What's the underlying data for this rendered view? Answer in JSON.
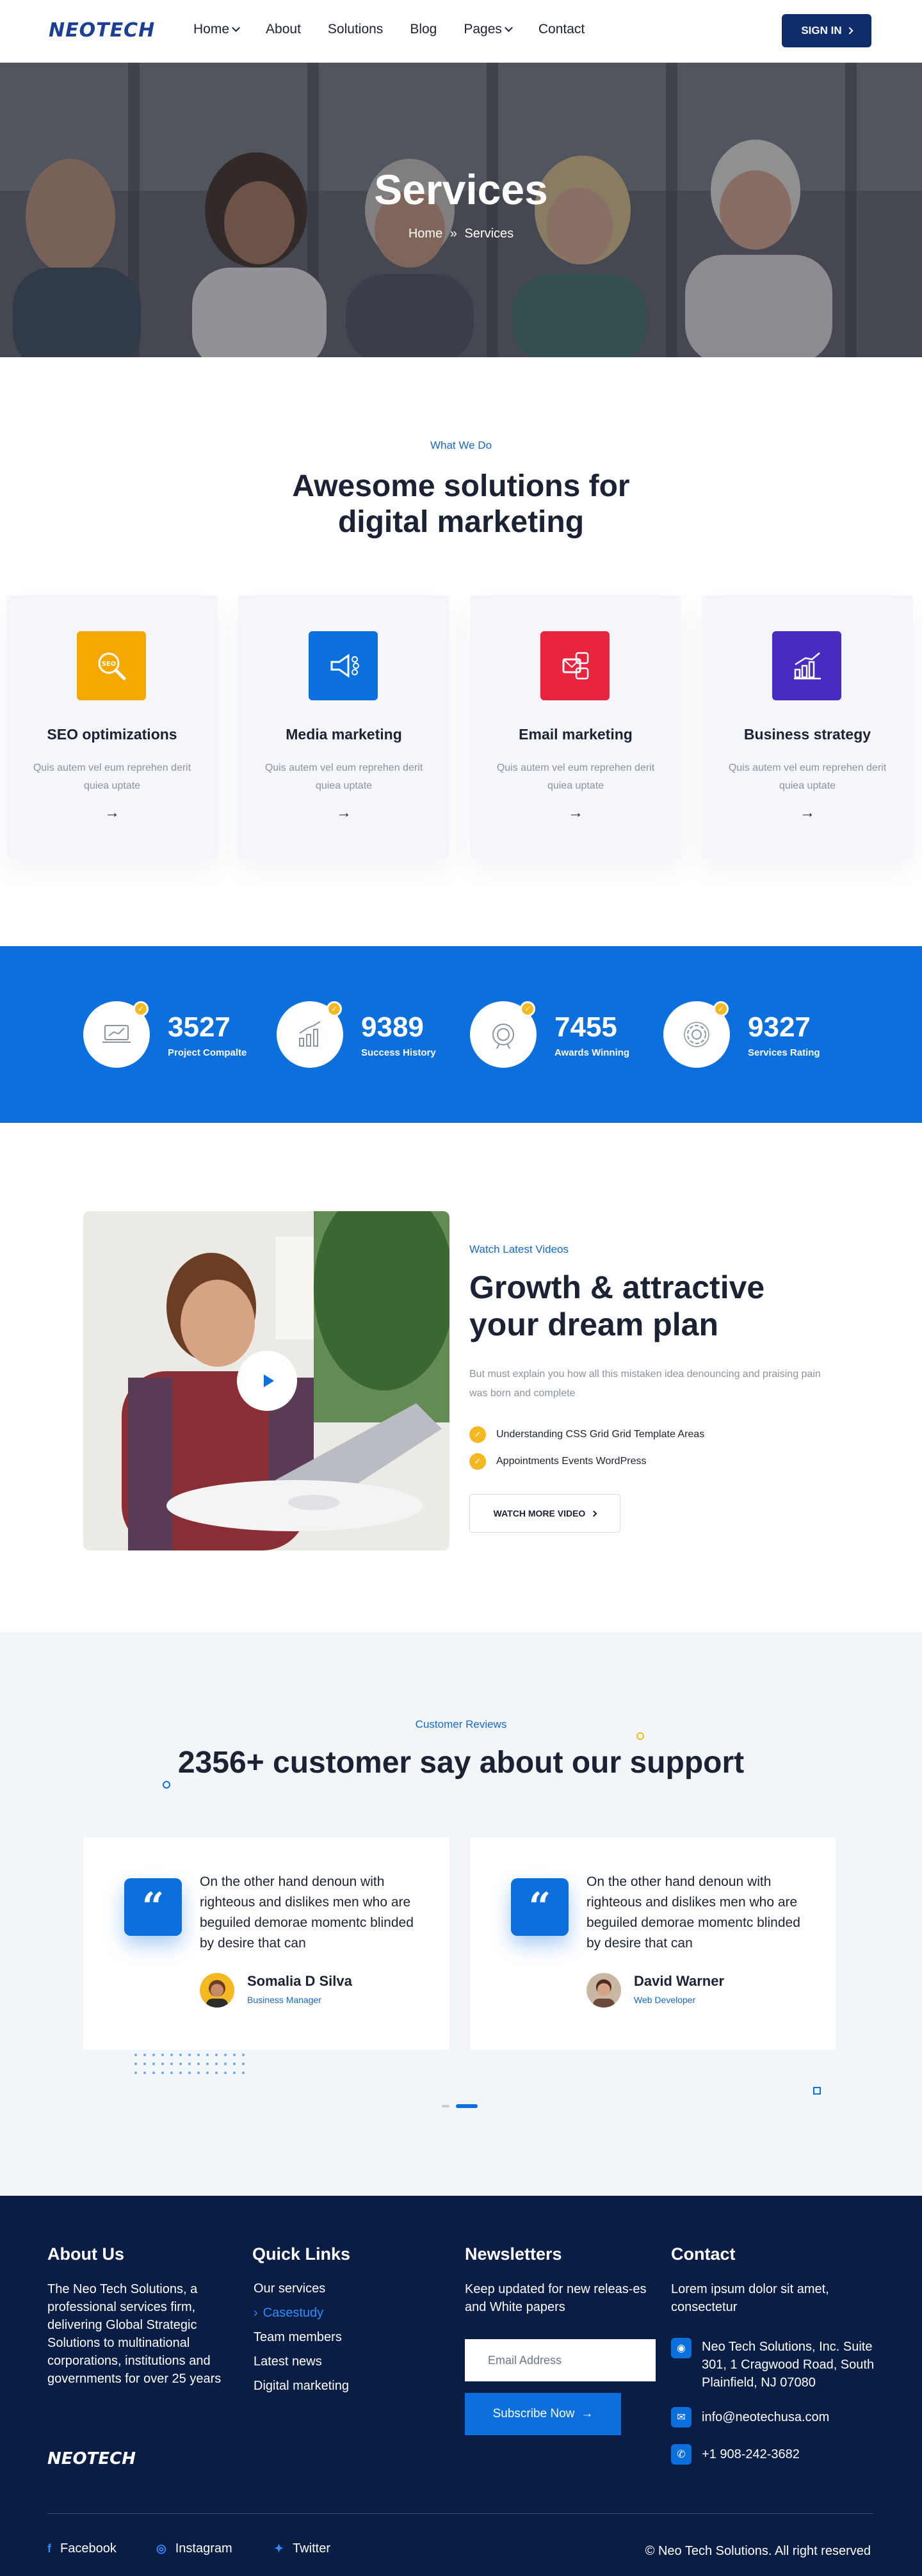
{
  "header": {
    "logo": "NEOTECH",
    "nav": [
      {
        "label": "Home",
        "dropdown": true
      },
      {
        "label": "About",
        "dropdown": false
      },
      {
        "label": "Solutions",
        "dropdown": false
      },
      {
        "label": "Blog",
        "dropdown": false
      },
      {
        "label": "Pages",
        "dropdown": true
      },
      {
        "label": "Contact",
        "dropdown": false
      }
    ],
    "signin_label": "SIGN IN"
  },
  "hero": {
    "title": "Services",
    "breadcrumb_home": "Home",
    "breadcrumb_sep": "»",
    "breadcrumb_current": "Services"
  },
  "what_we_do": {
    "kicker": "What We Do",
    "title_line1": "Awesome solutions for",
    "title_line2": "digital marketing",
    "cards": [
      {
        "title": "SEO optimizations",
        "text": "Quis autem vel eum reprehen derit quiea uptate",
        "icon": "seo-icon",
        "color": "#f5a800"
      },
      {
        "title": "Media marketing",
        "text": "Quis autem vel eum reprehen derit quiea uptate",
        "icon": "megaphone-icon",
        "color": "#0c6fde"
      },
      {
        "title": "Email marketing",
        "text": "Quis autem vel eum reprehen derit quiea uptate",
        "icon": "email-icon",
        "color": "#e8243f"
      },
      {
        "title": "Business strategy",
        "text": "Quis autem vel eum reprehen derit quiea uptate",
        "icon": "bar-chart-icon",
        "color": "#4a2bc2"
      }
    ]
  },
  "stats": [
    {
      "number": "3527",
      "label": "Project Compalte",
      "icon": "laptop-chart-icon"
    },
    {
      "number": "9389",
      "label": "Success History",
      "icon": "bar-graph-icon"
    },
    {
      "number": "7455",
      "label": "Awards Winning",
      "icon": "award-icon"
    },
    {
      "number": "9327",
      "label": "Services Rating",
      "icon": "gear-icon"
    }
  ],
  "video": {
    "kicker": "Watch Latest Videos",
    "title_line1": "Growth & attractive",
    "title_line2": "your dream plan",
    "text": "But must explain you how all this mistaken idea denouncing and praising pain was born and complete",
    "checks": [
      "Understanding CSS Grid Grid Template Areas",
      "Appointments Events WordPress"
    ],
    "button_label": "WATCH MORE VIDEO"
  },
  "reviews": {
    "kicker": "Customer Reviews",
    "title": "2356+ customer say about our support",
    "items": [
      {
        "text": "On the other hand denoun with righteous and dislikes men who are beguiled demorae momentc blinded by desire that can",
        "name": "Somalia D Silva",
        "role": "Business Manager"
      },
      {
        "text": "On the other hand denoun with righteous and dislikes men who are beguiled demorae momentc blinded by desire that can",
        "name": "David Warner",
        "role": "Web Developer"
      }
    ]
  },
  "footer": {
    "about_head": "About Us",
    "about_text": "The Neo Tech Solutions, a professional services firm, delivering Global Strategic Solutions to multinational corporations, institutions and governments for over 25 years",
    "logo": "NEOTECH",
    "links_head": "Quick Links",
    "links": [
      "Our services",
      "Casestudy",
      "Team members",
      "Latest news",
      "Digital marketing"
    ],
    "active_link": "Casestudy",
    "news_head": "Newsletters",
    "news_text": "Keep updated for new releas-es and White papers",
    "email_placeholder": "Email Address",
    "subscribe_label": "Subscribe Now",
    "contact_head": "Contact",
    "contact_text": "Lorem ipsum dolor sit amet, consectetur",
    "address": "Neo Tech Solutions, Inc. Suite 301, 1 Cragwood Road, South Plainfield, NJ 07080",
    "email": "info@neotechusa.com",
    "phone": "+1 908-242-3682",
    "social": [
      "Facebook",
      "Instagram",
      "Twitter"
    ],
    "copyright": "© Neo Tech Solutions. All right reserved"
  },
  "colors": {
    "primary": "#0c6fde",
    "navy": "#0a1e45",
    "accent": "#f4b922"
  }
}
